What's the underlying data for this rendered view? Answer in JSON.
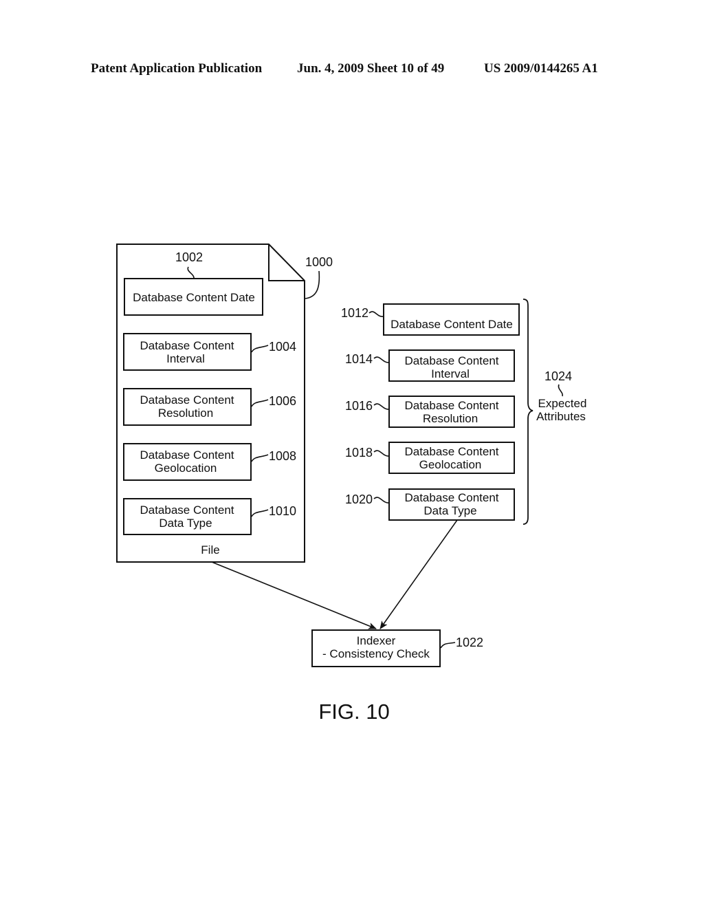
{
  "header": {
    "publication": "Patent Application Publication",
    "date_sheet": "Jun. 4, 2009   Sheet 10 of 49",
    "patent_number": "US 2009/0144265 A1"
  },
  "diagram": {
    "file": {
      "ref": "1000",
      "label": "File",
      "boxes": [
        {
          "ref": "1002",
          "lines": [
            "Database Content Date"
          ]
        },
        {
          "ref": "1004",
          "lines": [
            "Database Content",
            "Interval"
          ]
        },
        {
          "ref": "1006",
          "lines": [
            "Database Content",
            "Resolution"
          ]
        },
        {
          "ref": "1008",
          "lines": [
            "Database Content",
            "Geolocation"
          ]
        },
        {
          "ref": "1010",
          "lines": [
            "Database Content",
            "Data Type"
          ]
        }
      ]
    },
    "expected": {
      "ref": "1024",
      "label_lines": [
        "Expected",
        "Attributes"
      ],
      "boxes": [
        {
          "ref": "1012",
          "lines": [
            "Database Content Date"
          ]
        },
        {
          "ref": "1014",
          "lines": [
            "Database Content",
            "Interval"
          ]
        },
        {
          "ref": "1016",
          "lines": [
            "Database Content",
            "Resolution"
          ]
        },
        {
          "ref": "1018",
          "lines": [
            "Database Content",
            "Geolocation"
          ]
        },
        {
          "ref": "1020",
          "lines": [
            "Database Content",
            "Data Type"
          ]
        }
      ]
    },
    "indexer": {
      "ref": "1022",
      "lines": [
        "Indexer",
        "- Consistency Check"
      ]
    },
    "figure_label": "FIG. 10"
  }
}
